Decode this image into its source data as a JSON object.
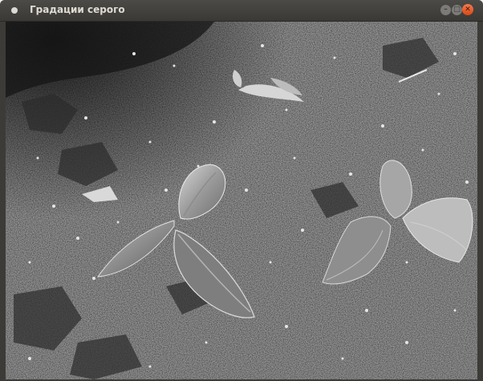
{
  "window": {
    "title": "Градации серого",
    "buttons": {
      "minimize_glyph": "–",
      "maximize_glyph": "□",
      "close_glyph": "✕"
    }
  },
  "image": {
    "description_icon": "grayscale-photo",
    "colors": {
      "accent_close": "#dd4814",
      "titlebar": "#3c3b37"
    }
  }
}
